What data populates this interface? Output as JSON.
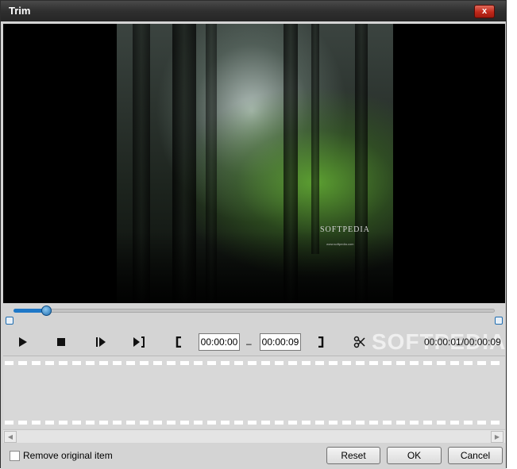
{
  "window": {
    "title": "Trim",
    "close_label": "x"
  },
  "preview": {
    "watermark": "SOFTPEDIA",
    "watermark_url": "www.softpedia.com"
  },
  "controls": {
    "start_time": "00:00:00",
    "dash": "–",
    "end_time": "00:00:09",
    "watermark": "SOFTPEDIA",
    "elapsed_total": "00:00:01/00:00:09"
  },
  "progress": {
    "position_fraction": 0.07
  },
  "options": {
    "remove_original_label": "Remove original item",
    "remove_original_checked": false
  },
  "buttons": {
    "reset": "Reset",
    "ok": "OK",
    "cancel": "Cancel"
  },
  "colors": {
    "accent": "#1e78c8",
    "close_button": "#c0281a"
  }
}
